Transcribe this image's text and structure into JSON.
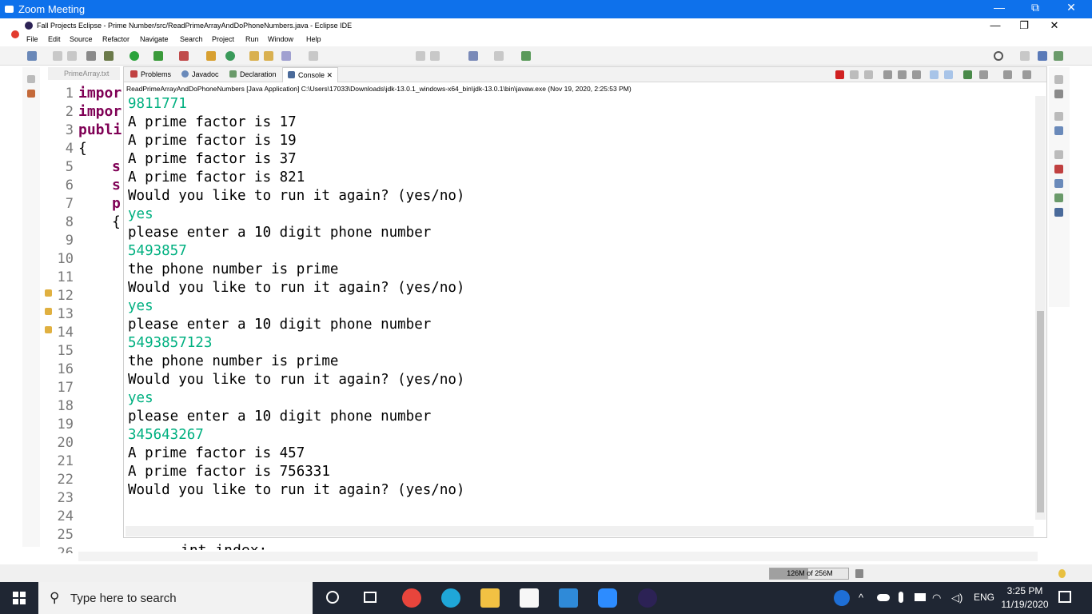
{
  "zoom": {
    "title": "Zoom Meeting",
    "minimize": "—",
    "restore": "⧉",
    "close": "✕"
  },
  "eclipse": {
    "title": "Fall Projects Eclipse - Prime Number/src/ReadPrimeArrayAndDoPhoneNumbers.java - Eclipse IDE",
    "minimize": "—",
    "restore": "❐",
    "close": "✕"
  },
  "menu": [
    "File",
    "Edit",
    "Source",
    "Refactor",
    "Navigate",
    "Search",
    "Project",
    "Run",
    "Window",
    "Help"
  ],
  "editor": {
    "tab_label": "PrimeArray.txt",
    "line_numbers": [
      "1",
      "2",
      "3",
      "4",
      "5",
      "6",
      "7",
      "8",
      "9",
      "10",
      "11",
      "12",
      "13",
      "14",
      "15",
      "16",
      "17",
      "18",
      "19",
      "20",
      "21",
      "22",
      "23",
      "24",
      "25",
      "26"
    ],
    "fragments": {
      "l1": "impor",
      "l2": "impor",
      "l3": "publi",
      "l4": "{",
      "l5": "s",
      "l6": "s",
      "l7": "p",
      "l8": "{",
      "l26": "int index;"
    }
  },
  "views": {
    "tabs": [
      "Problems",
      "Javadoc",
      "Declaration",
      "Console"
    ],
    "active_close": "✕"
  },
  "console": {
    "description": "ReadPrimeArrayAndDoPhoneNumbers [Java Application] C:\\Users\\17033\\Downloads\\jdk-13.0.1_windows-x64_bin\\jdk-13.0.1\\bin\\javaw.exe  (Nov 19, 2020, 2:25:53 PM)",
    "lines": [
      {
        "text": "9811771",
        "kind": "in"
      },
      {
        "text": "A prime factor is 17",
        "kind": "out"
      },
      {
        "text": "A prime factor is 19",
        "kind": "out"
      },
      {
        "text": "A prime factor is 37",
        "kind": "out"
      },
      {
        "text": "A prime factor is 821",
        "kind": "out"
      },
      {
        "text": "Would you like to run it again? (yes/no)",
        "kind": "out"
      },
      {
        "text": "yes",
        "kind": "in"
      },
      {
        "text": "please enter a 10 digit phone number",
        "kind": "out"
      },
      {
        "text": "5493857",
        "kind": "in"
      },
      {
        "text": "the phone number is prime",
        "kind": "out"
      },
      {
        "text": "Would you like to run it again? (yes/no)",
        "kind": "out"
      },
      {
        "text": "yes",
        "kind": "in"
      },
      {
        "text": "please enter a 10 digit phone number",
        "kind": "out"
      },
      {
        "text": "5493857123",
        "kind": "in"
      },
      {
        "text": "the phone number is prime",
        "kind": "out"
      },
      {
        "text": "Would you like to run it again? (yes/no)",
        "kind": "out"
      },
      {
        "text": "yes",
        "kind": "in"
      },
      {
        "text": "please enter a 10 digit phone number",
        "kind": "out"
      },
      {
        "text": "345643267",
        "kind": "in"
      },
      {
        "text": "A prime factor is 457",
        "kind": "out"
      },
      {
        "text": "A prime factor is 756331",
        "kind": "out"
      },
      {
        "text": "Would you like to run it again? (yes/no)",
        "kind": "out"
      }
    ]
  },
  "status": {
    "heap_label": "126M of 256M",
    "heap_fraction": 0.49
  },
  "taskbar": {
    "search_placeholder": "Type here to search",
    "language": "ENG",
    "time": "3:25 PM",
    "date": "11/19/2020"
  },
  "colors": {
    "zoom_blue": "#0e71eb",
    "console_input": "#00b080",
    "keyword": "#7f0055",
    "taskbar_bg": "#1f2633"
  }
}
